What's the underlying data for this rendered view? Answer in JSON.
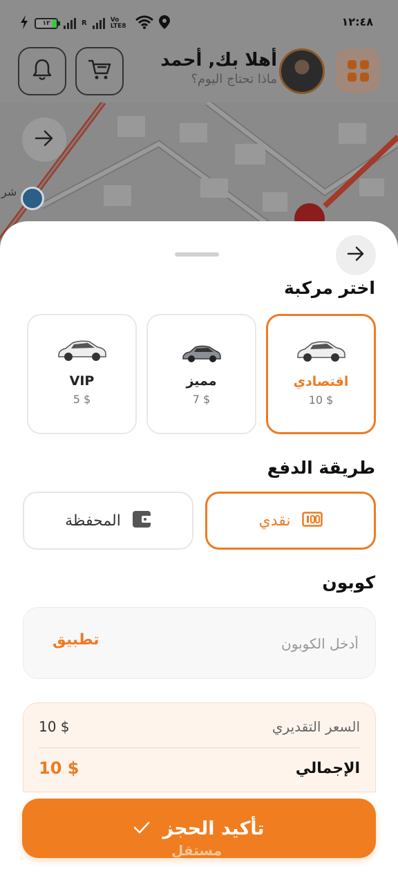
{
  "status_bar": {
    "time": "١٢:٤٨",
    "battery": "١٢",
    "network": "Vo LTE8",
    "roaming": "R"
  },
  "header": {
    "greeting": "أهلا بك, أحمد",
    "subtitle": "ماذا تحتاج اليوم؟",
    "icons": [
      "bell-icon",
      "cart-icon",
      "avatar",
      "grid-icon"
    ]
  },
  "map": {
    "label": "شر"
  },
  "sheet": {
    "vehicle_title": "اختر مركبة",
    "vehicles": [
      {
        "name": "اقتصادي",
        "price": "10 $",
        "selected": true
      },
      {
        "name": "مميز",
        "price": "7 $",
        "selected": false
      },
      {
        "name": "VIP",
        "price": "5 $",
        "selected": false
      }
    ],
    "payment_title": "طريقة الدفع",
    "payments": [
      {
        "label": "نقدي",
        "icon": "cash-icon",
        "selected": true
      },
      {
        "label": "المحفظة",
        "icon": "wallet-icon",
        "selected": false
      }
    ],
    "coupon_title": "كوبون",
    "coupon_placeholder": "أدخل الكوبون",
    "coupon_value": "",
    "coupon_apply": "تطبيق",
    "estimated_label": "السعر التقديري",
    "estimated_value": "10 $",
    "total_label": "الإجمالي",
    "total_value": "10 $",
    "confirm_label": "تأكيد الحجز",
    "watermark": "مستقل"
  },
  "colors": {
    "accent": "#F07D1F",
    "text": "#222222",
    "muted": "#777777"
  }
}
